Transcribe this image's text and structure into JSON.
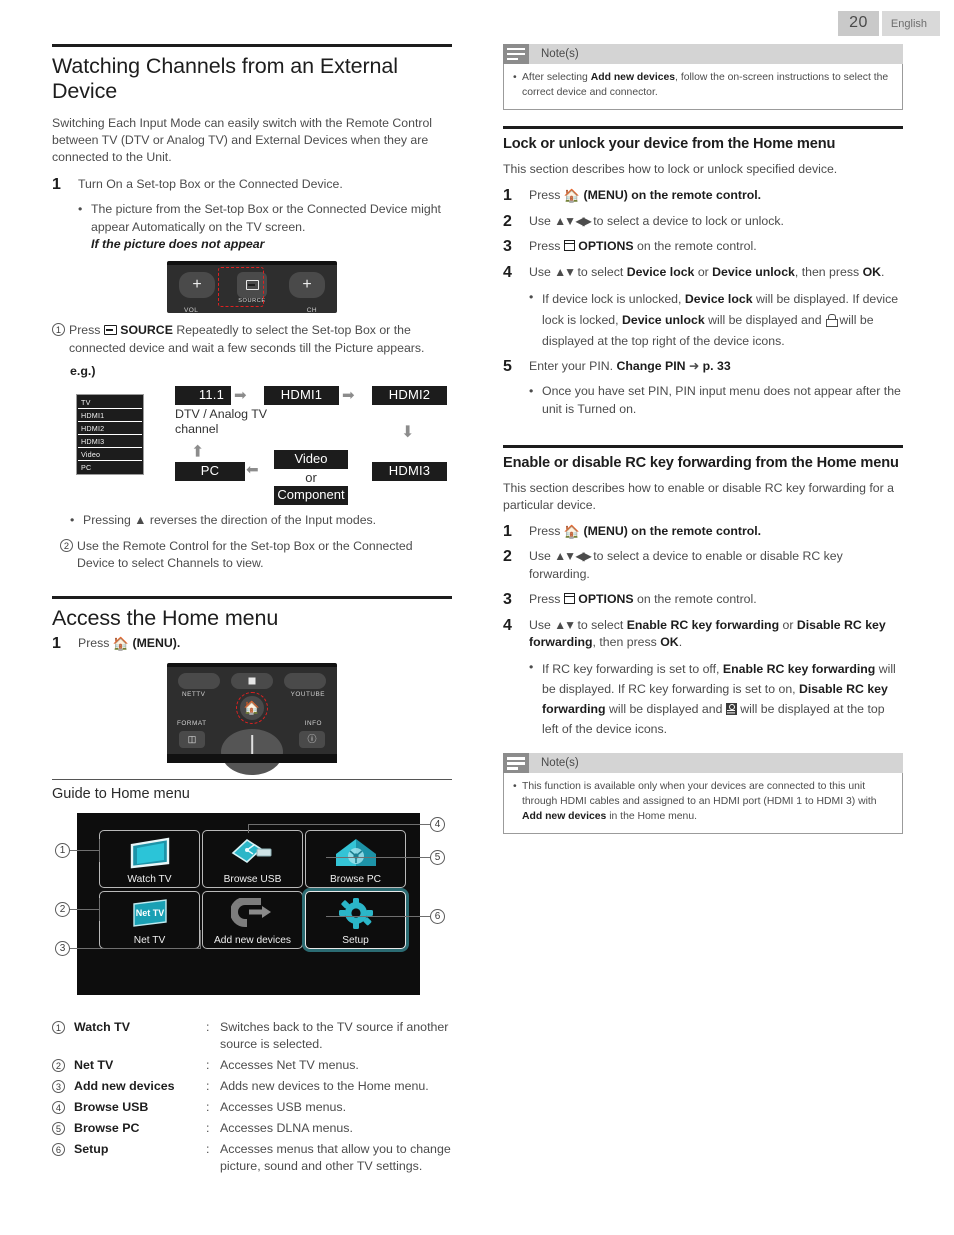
{
  "header": {
    "page_number": "20",
    "language": "English"
  },
  "left": {
    "section1": {
      "title": "Watching Channels from an External Device",
      "intro": "Switching Each Input Mode can easily switch with the Remote Control between TV (DTV or Analog TV) and External Devices when they are connected to the Unit.",
      "step1_num": "1",
      "step1_text": "Turn On a Set-top Box or the Connected Device.",
      "step1_bullet": "The picture from the Set-top Box or the Connected Device might appear Automatically on the TV screen.",
      "step1_italic": "If the picture does not appear",
      "remote": {
        "plus_left": "+",
        "plus_right": "+",
        "source_label": "SOURCE",
        "vol_label": "VOL",
        "ch_label": "CH",
        "source_icon": "source-input-icon",
        "highlight_color": "#e02020"
      },
      "item1_num": "1",
      "item1_text_pre": "Press",
      "item1_bold": "SOURCE",
      "item1_text_post": "Repeatedly to select the Set-top Box or the connected device and wait a few seconds till the Picture appears.",
      "eg_label": "e.g.)",
      "source_list": [
        "TV",
        "HDMI1",
        "HDMI2",
        "HDMI3",
        "Video",
        "PC"
      ],
      "flow": {
        "box_channel": "11.1",
        "box_hdmi1": "HDMI1",
        "box_hdmi2": "HDMI2",
        "box_hdmi3": "HDMI3",
        "box_pc": "PC",
        "box_video": "Video",
        "box_or": "or",
        "box_component": "Component",
        "caption_line1": "DTV / Analog TV",
        "caption_line2": "channel"
      },
      "bullet_reverse": "Pressing ▲ reverses the direction of the Input modes.",
      "item2_num": "2",
      "item2_text": "Use the Remote Control for the Set-top Box or the Connected Device to select Channels to view."
    },
    "section2": {
      "title": "Access the Home menu",
      "step1_num": "1",
      "step1_pre": "Press",
      "step1_post": "(MENU).",
      "remote": {
        "nettv_label": "NETTV",
        "youtube_label": "YOUTUBE",
        "format_label": "FORMAT",
        "info_label": "INFO",
        "home_icon": "home-icon",
        "format_icon": "format-icon",
        "info_icon": "info-icon",
        "stop_icon": "stop-icon"
      }
    },
    "section3": {
      "title": "Guide to Home menu",
      "home_menu_tiles": [
        {
          "label": "Watch TV",
          "icon": "tv-screen-icon",
          "selected": false
        },
        {
          "label": "Browse USB",
          "icon": "usb-stick-icon",
          "selected": false
        },
        {
          "label": "Browse PC",
          "icon": "house-network-icon",
          "selected": false
        },
        {
          "label": "Net TV",
          "icon": "nettv-logo-icon",
          "selected": false
        },
        {
          "label": "Add new devices",
          "icon": "plug-arrow-icon",
          "selected": false
        },
        {
          "label": "Setup",
          "icon": "gear-icon",
          "selected": true
        }
      ],
      "callout_numbers": [
        "1",
        "2",
        "3",
        "4",
        "5",
        "6"
      ],
      "legend": [
        {
          "num": "1",
          "term": "Watch TV",
          "sep": ":",
          "desc": "Switches back to the TV source if another source is selected."
        },
        {
          "num": "2",
          "term": "Net TV",
          "sep": ":",
          "desc": "Accesses Net TV menus."
        },
        {
          "num": "3",
          "term": "Add new devices",
          "sep": ":",
          "desc": "Adds new devices to the Home menu."
        },
        {
          "num": "4",
          "term": "Browse USB",
          "sep": ":",
          "desc": "Accesses USB menus."
        },
        {
          "num": "5",
          "term": "Browse PC",
          "sep": ":",
          "desc": "Accesses DLNA menus."
        },
        {
          "num": "6",
          "term": "Setup",
          "sep": ":",
          "desc": "Accesses menus that allow you to change picture, sound and other TV settings."
        }
      ]
    }
  },
  "right": {
    "note_top": {
      "title": "Note(s)",
      "icon": "note-lines-icon",
      "bullet_pre": "After selecting",
      "bullet_bold": "Add new devices",
      "bullet_post": ", follow the on-screen instructions to select the correct device and connector."
    },
    "section_lock": {
      "title": "Lock or unlock your device from the Home menu",
      "intro": "This section describes how to lock or unlock specified device.",
      "steps": [
        {
          "num": "1",
          "pre": "Press",
          "icon": "home-icon",
          "post": "(MENU) on the remote control."
        },
        {
          "num": "2",
          "pre": "Use",
          "icon": "dpad-arrows",
          "post": "to select a device to lock or unlock."
        },
        {
          "num": "3",
          "pre": "Press",
          "icon": "options-icon",
          "bold": "OPTIONS",
          "post": "on the remote control."
        },
        {
          "num": "4",
          "pre": "Use",
          "icon": "updown-arrows",
          "post": "to select",
          "bold1": "Device lock",
          "mid": "or",
          "bold2": "Device unlock",
          "tail": ", then press",
          "bold3": "OK",
          "end": "."
        }
      ],
      "bullet4_part1": "If device lock is unlocked,",
      "bullet4_bold1": "Device lock",
      "bullet4_part2": "will be displayed. If device lock is locked,",
      "bullet4_bold2": "Device unlock",
      "bullet4_part3": "will be displayed and",
      "bullet4_icon": "lock-icon",
      "bullet4_part4": "will be displayed at the top right of the device icons.",
      "step5_num": "5",
      "step5_pre": "Enter your PIN.",
      "step5_bold": "Change PIN",
      "step5_arrow": "➜",
      "step5_page": "p. 33",
      "bullet5": "Once you have set PIN, PIN input menu does not appear after the unit is Turned on."
    },
    "section_rc": {
      "title": "Enable or disable RC key forwarding from the Home menu",
      "intro": "This section describes how to enable or disable RC key forwarding for a particular device.",
      "steps": [
        {
          "num": "1",
          "pre": "Press",
          "icon": "home-icon",
          "post": "(MENU) on the remote control."
        },
        {
          "num": "2",
          "pre": "Use",
          "icon": "dpad-arrows",
          "post": "to select a device to enable or disable RC key forwarding."
        },
        {
          "num": "3",
          "pre": "Press",
          "icon": "options-icon",
          "bold": "OPTIONS",
          "post": "on the remote control."
        },
        {
          "num": "4",
          "pre": "Use",
          "icon": "updown-arrows",
          "post": "to select",
          "bold1": "Enable RC key forwarding",
          "mid": "or",
          "bold2": "Disable RC key forwarding",
          "tail": ", then press",
          "bold3": "OK",
          "end": "."
        }
      ],
      "bullet4_part1": "If RC key forwarding is set to off,",
      "bullet4_bold1": "Enable RC key forwarding",
      "bullet4_part2": "will be displayed. If RC key forwarding is set to on,",
      "bullet4_bold2": "Disable RC key forwarding",
      "bullet4_part3": "will be displayed and",
      "bullet4_icon": "rc-forward-icon",
      "bullet4_part4": "will be displayed at the top left of the device icons."
    },
    "note_bottom": {
      "title": "Note(s)",
      "icon": "note-lines-icon",
      "bullet_part1": "This function is available only when your devices are connected to this unit through HDMI cables and assigned to an HDMI port (HDMI 1 to HDMI 3) with",
      "bullet_bold": "Add new devices",
      "bullet_part2": "in the Home menu."
    }
  },
  "colors": {
    "accent_red": "#e02020",
    "tile_teal": "#2bb6c8",
    "dark_panel": "#0d0d0d",
    "badge_grey": "#c9c9c9"
  }
}
